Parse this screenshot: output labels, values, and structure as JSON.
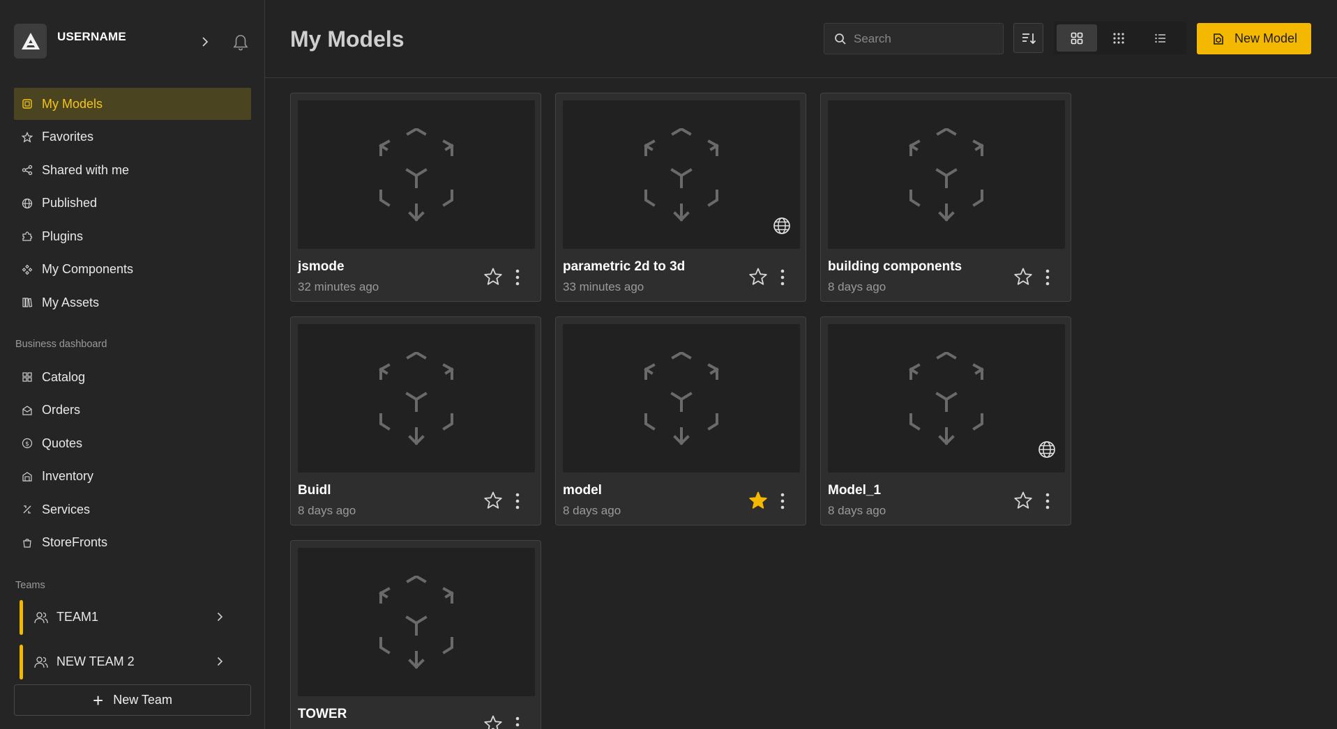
{
  "profile": {
    "username": "USERNAME"
  },
  "nav": {
    "items": [
      {
        "label": "My Models",
        "icon": "models-icon",
        "active": true
      },
      {
        "label": "Favorites",
        "icon": "star-icon"
      },
      {
        "label": "Shared with me",
        "icon": "share-icon"
      },
      {
        "label": "Published",
        "icon": "globe-icon"
      },
      {
        "label": "Plugins",
        "icon": "puzzle-icon"
      },
      {
        "label": "My Components",
        "icon": "components-icon"
      },
      {
        "label": "My Assets",
        "icon": "assets-icon"
      }
    ],
    "business_label": "Business dashboard",
    "business_items": [
      {
        "label": "Catalog",
        "icon": "catalog-icon"
      },
      {
        "label": "Orders",
        "icon": "orders-icon"
      },
      {
        "label": "Quotes",
        "icon": "quotes-icon"
      },
      {
        "label": "Inventory",
        "icon": "inventory-icon"
      },
      {
        "label": "Services",
        "icon": "services-icon"
      },
      {
        "label": "StoreFronts",
        "icon": "storefront-icon"
      }
    ],
    "teams_label": "Teams",
    "teams": [
      {
        "label": "TEAM1"
      },
      {
        "label": "NEW TEAM 2"
      }
    ],
    "new_team_label": "New Team"
  },
  "header": {
    "title": "My Models",
    "search_placeholder": "Search",
    "new_model_label": "New Model",
    "active_view": "grid-large"
  },
  "colors": {
    "accent": "#f5b800",
    "active_nav_bg": "#4a4420",
    "active_nav_text": "#f5c518",
    "background": "#232323"
  },
  "models": [
    {
      "name": "jsmode",
      "time": "32 minutes ago",
      "favorite": false,
      "published": false
    },
    {
      "name": "parametric 2d to 3d",
      "time": "33 minutes ago",
      "favorite": false,
      "published": true
    },
    {
      "name": "building components",
      "time": "8 days ago",
      "favorite": false,
      "published": false
    },
    {
      "name": "Buidl",
      "time": "8 days ago",
      "favorite": false,
      "published": false
    },
    {
      "name": "model",
      "time": "8 days ago",
      "favorite": true,
      "published": false
    },
    {
      "name": "Model_1",
      "time": "8 days ago",
      "favorite": false,
      "published": true
    },
    {
      "name": "TOWER",
      "time": "",
      "favorite": false,
      "published": false
    }
  ]
}
